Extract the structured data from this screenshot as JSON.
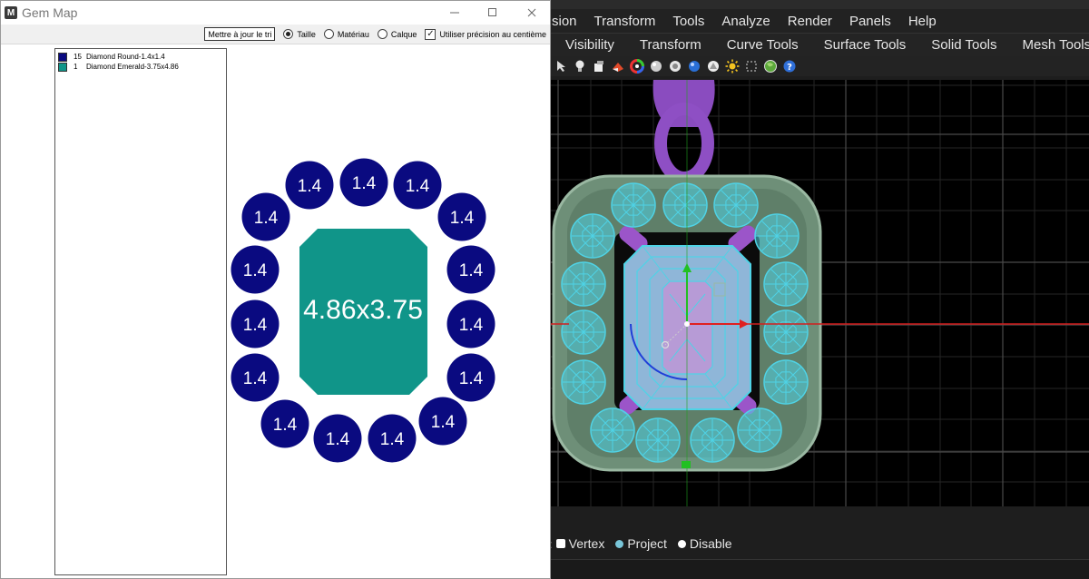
{
  "rhino": {
    "menu": [
      "sion",
      "Transform",
      "Tools",
      "Analyze",
      "Render",
      "Panels",
      "Help"
    ],
    "tabs": [
      "Visibility",
      "Transform",
      "Curve Tools",
      "Surface Tools",
      "Solid Tools",
      "Mesh Tools"
    ],
    "toolbar_icons": [
      "cursor-icon",
      "light-icon",
      "render-icon",
      "material-icon",
      "color-wheel-icon",
      "sphere-icon",
      "environment-icon",
      "metal-sphere-icon",
      "gem-sphere-icon",
      "sun-icon",
      "camera-icon",
      "globe-icon",
      "help-icon"
    ],
    "osnap": {
      "vertex_label": "Vertex",
      "project_label": "Project",
      "disable_label": "Disable"
    },
    "colors": {
      "gems": "#4fd3e6",
      "metal": "#6e8f78",
      "prongs": "#9b55c9",
      "axis_x": "#d21e1e",
      "axis_y": "#1ea01e"
    }
  },
  "gem_map": {
    "window_title": "Gem Map",
    "app_icon": "M",
    "update_button": "Mettre à jour le tri",
    "sort_options": [
      {
        "label": "Taille",
        "selected": true
      },
      {
        "label": "Matériau",
        "selected": false
      },
      {
        "label": "Calque",
        "selected": false
      }
    ],
    "precision_label": "Utiliser précision au centième",
    "precision_checked": true,
    "legend": [
      {
        "qty": "15",
        "name": "Diamond Round-1.4x1.4",
        "color": "#0a0a80"
      },
      {
        "qty": "1",
        "name": "Diamond Emerald-3.75x4.86",
        "color": "#109589"
      }
    ],
    "center_stone_label": "4.86x3.75",
    "round_stone_label": "1.4",
    "round_stone_count": 15,
    "colors": {
      "round": "#0a0a80",
      "emerald": "#109589"
    }
  }
}
